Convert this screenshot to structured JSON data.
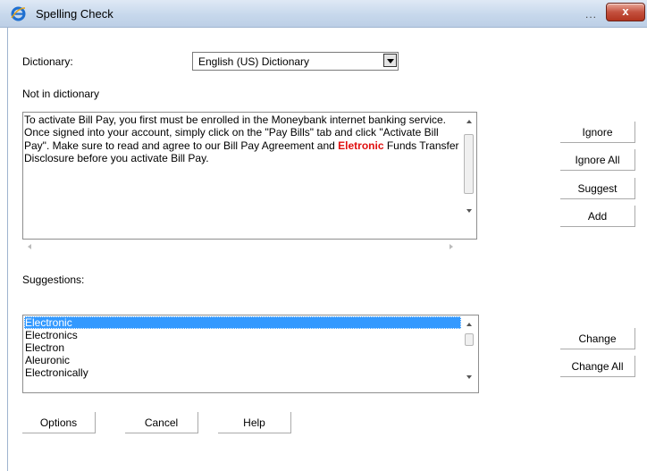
{
  "window": {
    "title": "Spelling Check",
    "title_overflow": "...",
    "close_label": "x"
  },
  "dictionary": {
    "label": "Dictionary:",
    "selected": "English (US) Dictionary"
  },
  "not_in_dictionary": {
    "label": "Not in dictionary",
    "text_before": "To activate Bill Pay, you first must be enrolled in the Moneybank internet banking service. Once signed into your account, simply click on the \"Pay Bills\" tab and click \"Activate Bill Pay\". Make sure to read and agree to our Bill Pay Agreement and ",
    "misspelled_word": "Eletronic",
    "text_after": " Funds Transfer Disclosure before you activate Bill Pay."
  },
  "actions": {
    "ignore": "Ignore",
    "ignore_all": "Ignore All",
    "suggest": "Suggest",
    "add": "Add"
  },
  "suggestions": {
    "label": "Suggestions:",
    "items": [
      "Electronic",
      "Electronics",
      "Electron",
      "Aleuronic",
      "Electronically"
    ],
    "selected_index": 0
  },
  "change": {
    "change": "Change",
    "change_all": "Change All"
  },
  "footer": {
    "options": "Options",
    "cancel": "Cancel",
    "help": "Help"
  },
  "colors": {
    "misspelled": "#e01010",
    "selection": "#3399ff",
    "titlebar": "#c7d8ec",
    "close": "#c4513f"
  }
}
